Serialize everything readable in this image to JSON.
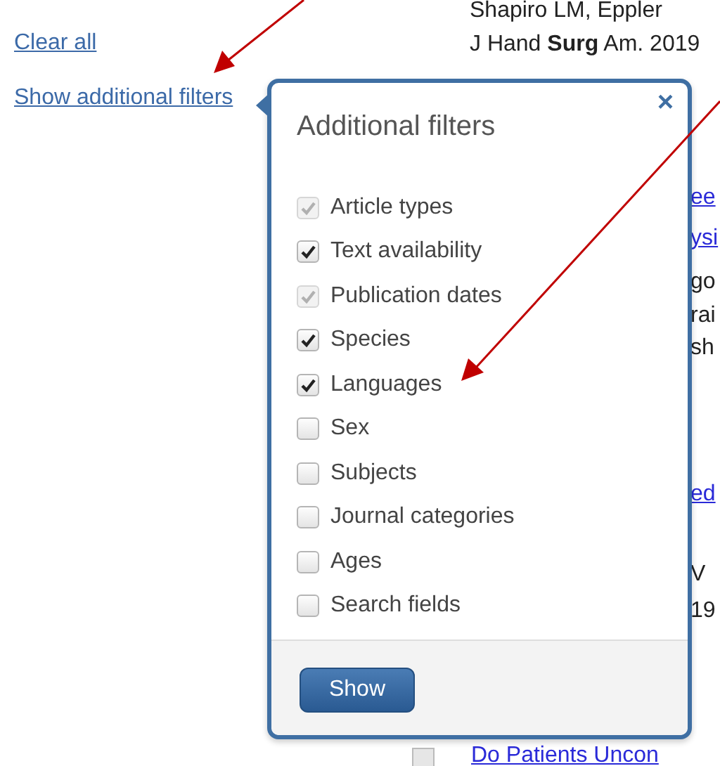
{
  "sidebar": {
    "links": [
      "Clear all",
      "Show additional filters"
    ]
  },
  "results": {
    "authors": "Shapiro LM, Eppler",
    "journal": "J Hand **Surg** Am. 2019",
    "fragments": [
      {
        "text": "ee",
        "kind": "link"
      },
      {
        "text": "ysi",
        "kind": "link"
      },
      {
        "text": "go",
        "kind": "text"
      },
      {
        "text": "rai",
        "kind": "text"
      },
      {
        "text": "sh",
        "kind": "text"
      },
      {
        "text": "ed",
        "kind": "link"
      },
      {
        "text": "V",
        "kind": "text"
      },
      {
        "text": "19",
        "kind": "text"
      }
    ],
    "next_title": "Do Patients Uncon",
    "next_checked": false
  },
  "popup": {
    "title": "Additional filters",
    "close": "×",
    "filters": [
      {
        "label": "Article types",
        "checked": true,
        "disabled": true
      },
      {
        "label": "Text availability",
        "checked": true,
        "disabled": false
      },
      {
        "label": "Publication dates",
        "checked": true,
        "disabled": true
      },
      {
        "label": "Species",
        "checked": true,
        "disabled": false
      },
      {
        "label": "Languages",
        "checked": true,
        "disabled": false
      },
      {
        "label": "Sex",
        "checked": false,
        "disabled": false
      },
      {
        "label": "Subjects",
        "checked": false,
        "disabled": false
      },
      {
        "label": "Journal categories",
        "checked": false,
        "disabled": false
      },
      {
        "label": "Ages",
        "checked": false,
        "disabled": false
      },
      {
        "label": "Search fields",
        "checked": false,
        "disabled": false
      }
    ],
    "button": "Show"
  }
}
